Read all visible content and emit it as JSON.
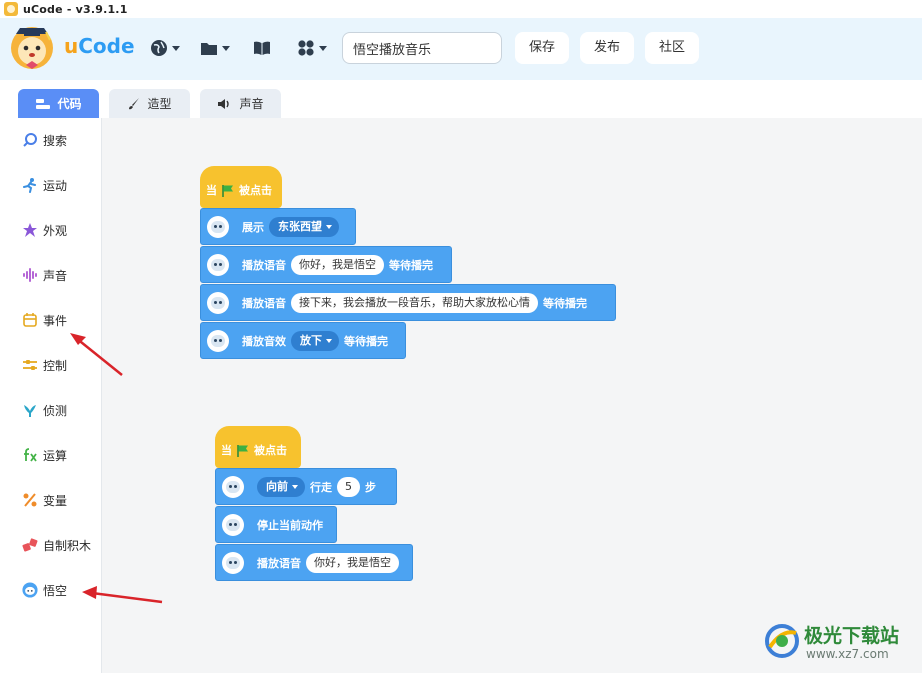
{
  "window": {
    "title": "uCode - v3.9.1.1"
  },
  "header": {
    "logo_u": "u",
    "logo_rest": "Code",
    "project_name": "悟空播放音乐",
    "buttons": {
      "save": "保存",
      "publish": "发布",
      "community": "社区"
    }
  },
  "tabs": [
    {
      "label": "代码",
      "active": true
    },
    {
      "label": "造型",
      "active": false
    },
    {
      "label": "声音",
      "active": false
    }
  ],
  "sidebar": {
    "items": [
      {
        "label": "搜索",
        "icon": "search-icon",
        "color": "#4a7fe8"
      },
      {
        "label": "运动",
        "icon": "run-icon",
        "color": "#3a8fe0"
      },
      {
        "label": "外观",
        "icon": "star-icon",
        "color": "#8a57d8"
      },
      {
        "label": "声音",
        "icon": "waveform-icon",
        "color": "#b566d6"
      },
      {
        "label": "事件",
        "icon": "calendar-icon",
        "color": "#e5a921"
      },
      {
        "label": "控制",
        "icon": "sliders-icon",
        "color": "#e5a921"
      },
      {
        "label": "侦测",
        "icon": "bird-icon",
        "color": "#2ba6c9"
      },
      {
        "label": "运算",
        "icon": "fx-icon",
        "color": "#44b348"
      },
      {
        "label": "变量",
        "icon": "percent-icon",
        "color": "#ef8c2a"
      },
      {
        "label": "自制积木",
        "icon": "blocks-icon",
        "color": "#e8545a"
      },
      {
        "label": "悟空",
        "icon": "robot-avatar-icon",
        "color": "#4ca3f2"
      }
    ]
  },
  "script1": {
    "hat": {
      "prefix": "当",
      "suffix": "被点击"
    },
    "blocks": [
      {
        "parts": [
          {
            "t": "text",
            "v": "展示"
          },
          {
            "t": "drop",
            "v": "东张西望"
          }
        ]
      },
      {
        "parts": [
          {
            "t": "text",
            "v": "播放语音"
          },
          {
            "t": "input",
            "v": "你好，我是悟空"
          },
          {
            "t": "text",
            "v": "等待播完"
          }
        ]
      },
      {
        "parts": [
          {
            "t": "text",
            "v": "播放语音"
          },
          {
            "t": "input",
            "v": "接下来，我会播放一段音乐，帮助大家放松心情"
          },
          {
            "t": "text",
            "v": "等待播完"
          }
        ]
      },
      {
        "parts": [
          {
            "t": "text",
            "v": "播放音效"
          },
          {
            "t": "drop",
            "v": "放下"
          },
          {
            "t": "text",
            "v": "等待播完"
          }
        ]
      }
    ]
  },
  "script2": {
    "hat": {
      "prefix": "当",
      "suffix": "被点击"
    },
    "blocks": [
      {
        "parts": [
          {
            "t": "drop",
            "v": "向前"
          },
          {
            "t": "text",
            "v": "行走"
          },
          {
            "t": "input",
            "v": "5"
          },
          {
            "t": "text",
            "v": "步"
          }
        ]
      },
      {
        "parts": [
          {
            "t": "text",
            "v": "停止当前动作"
          }
        ]
      },
      {
        "parts": [
          {
            "t": "text",
            "v": "播放语音"
          },
          {
            "t": "input",
            "v": "你好，我是悟空"
          }
        ]
      }
    ]
  },
  "watermark": {
    "name": "极光下载站",
    "url": "www.xz7.com"
  },
  "colors": {
    "hat": "#f7c22e",
    "block": "#4ca3f2",
    "accent_tab": "#5a8ef6",
    "arrow": "#d9242a"
  }
}
